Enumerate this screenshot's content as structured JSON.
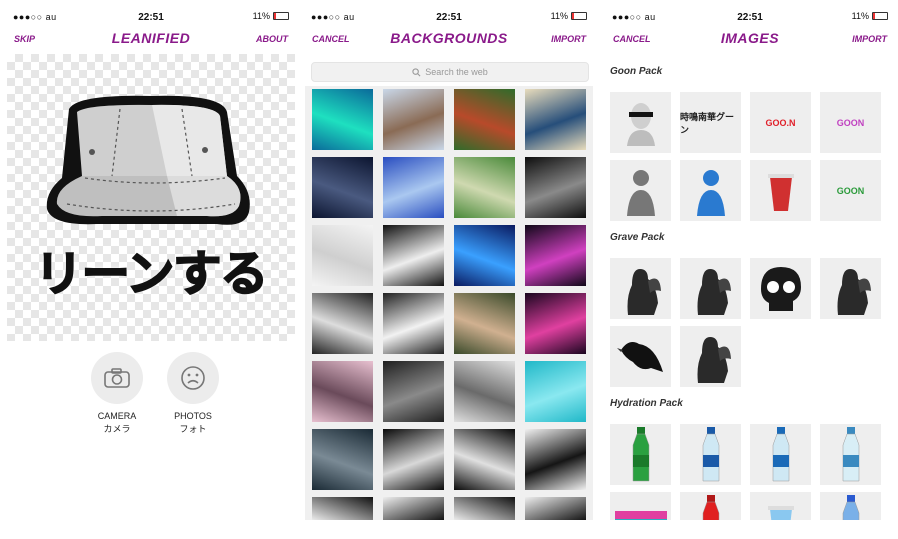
{
  "status": {
    "carrier": "●●●○○ au",
    "time": "22:51",
    "battery": "11%"
  },
  "leanify": {
    "nav": {
      "left": "SKIP",
      "title": "LEANIFIED",
      "right": "ABOUT"
    },
    "caption": "リーンする",
    "camera": {
      "label": "CAMERA",
      "sublabel": "カメラ",
      "icon": "camera-icon"
    },
    "photos": {
      "label": "PHOTOS",
      "sublabel": "フォト",
      "icon": "sad-face-icon"
    }
  },
  "backgrounds": {
    "nav": {
      "left": "CANCEL",
      "title": "BACKGROUNDS",
      "right": "IMPORT"
    },
    "search_placeholder": "Search the web",
    "thumbs": [
      {
        "name": "blue-waterfall-mirror",
        "c1": "#0a6a9a",
        "c2": "#1ee0c0"
      },
      {
        "name": "pagoda",
        "c1": "#c9d7e8",
        "c2": "#8a6b55"
      },
      {
        "name": "japanese-garden",
        "c1": "#2f6b2a",
        "c2": "#b84a2a"
      },
      {
        "name": "great-wave",
        "c1": "#e8dcbc",
        "c2": "#264e7a"
      },
      {
        "name": "night-moon",
        "c1": "#0c1530",
        "c2": "#4a5a80"
      },
      {
        "name": "pixel-sky-cloud",
        "c1": "#2a4ec0",
        "c2": "#aac8f0"
      },
      {
        "name": "forest-path",
        "c1": "#4a8a3a",
        "c2": "#cfd9b0"
      },
      {
        "name": "black-marble",
        "c1": "#0e0e0e",
        "c2": "#8a8a8a"
      },
      {
        "name": "white-texture",
        "c1": "#f4f4f4",
        "c2": "#cfcfcf"
      },
      {
        "name": "glitch-bw",
        "c1": "#111111",
        "c2": "#eeeeee"
      },
      {
        "name": "blue-waterfall",
        "c1": "#0a1a60",
        "c2": "#3aa0ff"
      },
      {
        "name": "neon-grid",
        "c1": "#100818",
        "c2": "#d040c0"
      },
      {
        "name": "glitch-blocks",
        "c1": "#222222",
        "c2": "#dddddd"
      },
      {
        "name": "white-stripes",
        "c1": "#222222",
        "c2": "#f2f2f2"
      },
      {
        "name": "misty-forest",
        "c1": "#3a4a2a",
        "c2": "#d0b090"
      },
      {
        "name": "pink-nebula",
        "c1": "#1a0620",
        "c2": "#e040a0"
      },
      {
        "name": "cherry-blossoms",
        "c1": "#e8c0d0",
        "c2": "#6a4a5a"
      },
      {
        "name": "dark-cross",
        "c1": "#202020",
        "c2": "#8a8a8a"
      },
      {
        "name": "foggy-crosses",
        "c1": "#e0e0e0",
        "c2": "#6a6a6a"
      },
      {
        "name": "turquoise-water",
        "c1": "#20b8c8",
        "c2": "#8ae8f0"
      },
      {
        "name": "foggy-trees",
        "c1": "#1a2a35",
        "c2": "#7a8a95"
      },
      {
        "name": "moon-black",
        "c1": "#0a0a0a",
        "c2": "#d8d8d8"
      },
      {
        "name": "moon-rays",
        "c1": "#0a0a0a",
        "c2": "#e0e0e0"
      },
      {
        "name": "black-splash",
        "c1": "#f0f0f0",
        "c2": "#151515"
      },
      {
        "name": "glitch-row-1",
        "c1": "#111111",
        "c2": "#eeeeee"
      },
      {
        "name": "glitch-row-2",
        "c1": "#eeeeee",
        "c2": "#111111"
      },
      {
        "name": "glitch-row-3",
        "c1": "#111111",
        "c2": "#eeeeee"
      },
      {
        "name": "glitch-row-4",
        "c1": "#eeeeee",
        "c2": "#111111"
      }
    ]
  },
  "images": {
    "nav": {
      "left": "CANCEL",
      "title": "IMAGES",
      "right": "IMPORT"
    },
    "packs": [
      {
        "title": "Goon Pack",
        "items": [
          {
            "name": "statue-bust",
            "kind": "bust"
          },
          {
            "name": "japanese-text",
            "kind": "text",
            "text": "時鳴南華グーン",
            "color": "#222"
          },
          {
            "name": "goon-logo-red",
            "kind": "text",
            "text": "GOO.N",
            "color": "#e0202a"
          },
          {
            "name": "goon-graffiti",
            "kind": "text",
            "text": "GOON",
            "color": "#c040c0"
          },
          {
            "name": "girl-photo",
            "kind": "person",
            "color": "#777"
          },
          {
            "name": "blue-hoodie-guy",
            "kind": "person",
            "color": "#2a7ad0"
          },
          {
            "name": "drink-cup",
            "kind": "cup",
            "color": "#d03030"
          },
          {
            "name": "green-letters",
            "kind": "text",
            "text": "GOON",
            "color": "#2a9a3a"
          }
        ]
      },
      {
        "title": "Grave Pack",
        "items": [
          {
            "name": "angel-statue-1",
            "kind": "statue"
          },
          {
            "name": "praying-statue",
            "kind": "statue"
          },
          {
            "name": "skull",
            "kind": "skull"
          },
          {
            "name": "winged-angel",
            "kind": "statue"
          },
          {
            "name": "black-crow",
            "kind": "crow"
          },
          {
            "name": "angel-statue-2",
            "kind": "statue"
          }
        ]
      },
      {
        "title": "Hydration Pack",
        "items": [
          {
            "name": "green-soda-bottle",
            "kind": "bottle",
            "color": "#2aa040",
            "cap": "#1a7a2a"
          },
          {
            "name": "water-bottle-1",
            "kind": "bottle",
            "color": "#cfe8f4",
            "cap": "#1a5aa8"
          },
          {
            "name": "water-bottle-2",
            "kind": "bottle",
            "color": "#cfe8f4",
            "cap": "#1a6ab8"
          },
          {
            "name": "water-bottle-3",
            "kind": "bottle",
            "color": "#d8eef6",
            "cap": "#3a8ac0"
          },
          {
            "name": "vaporwave-box",
            "kind": "box",
            "color": "#2ab0c0"
          },
          {
            "name": "red-sports-drink",
            "kind": "bottle",
            "color": "#e02020",
            "cap": "#b01818"
          },
          {
            "name": "ice-cup",
            "kind": "cup",
            "color": "#8ac8f0"
          },
          {
            "name": "ramune-bottle",
            "kind": "bottle",
            "color": "#7ab0e8",
            "cap": "#2a5ad0"
          }
        ]
      }
    ]
  }
}
